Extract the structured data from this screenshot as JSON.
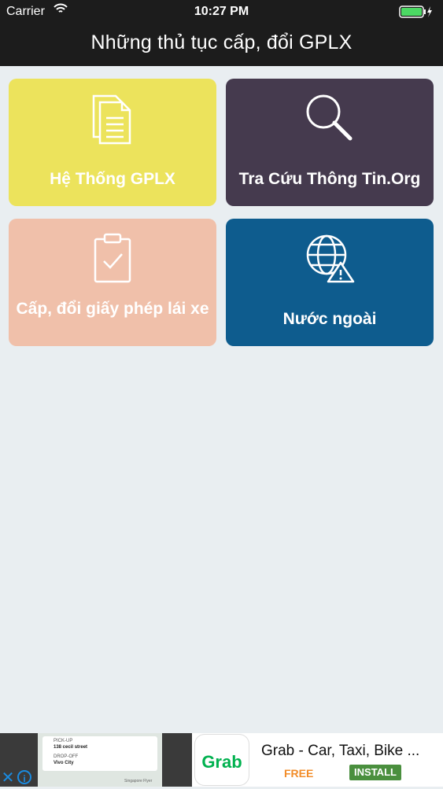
{
  "status_bar": {
    "carrier": "Carrier",
    "time": "10:27 PM"
  },
  "nav": {
    "title": "Những thủ tục cấp, đổi GPLX"
  },
  "tiles": [
    {
      "label": "Hệ Thống GPLX",
      "icon": "document-icon",
      "color": "#ece35c"
    },
    {
      "label": "Tra Cứu Thông Tin.Org",
      "icon": "search-icon",
      "color": "#453a4e"
    },
    {
      "label": "Cấp, đổi giấy phép lái xe",
      "icon": "clipboard-check-icon",
      "color": "#f0c0aa"
    },
    {
      "label": "Nước ngoài",
      "icon": "globe-warning-icon",
      "color": "#0e5c8e"
    }
  ],
  "ad": {
    "title": "Grab - Car, Taxi, Bike ...",
    "free_label": "FREE",
    "install_label": "INSTALL",
    "logo_text": "Grab",
    "pickup_label": "PICK-UP",
    "pickup_value": "138 cecil street",
    "dropoff_label": "DROP-OFF",
    "dropoff_value": "Vivo City",
    "map_caption": "Singapore Flyer"
  }
}
